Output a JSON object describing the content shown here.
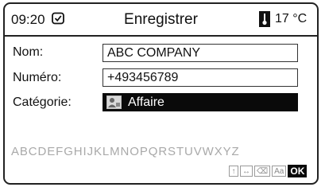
{
  "header": {
    "time": "09:20",
    "title": "Enregistrer",
    "temperature": "17 °C",
    "clock_icon": "clock-check-icon",
    "temperature_icon": "thermometer-icon"
  },
  "form": {
    "name_label": "Nom:",
    "name_value": "ABC COMPANY",
    "number_label": "Numéro:",
    "number_value": "+493456789",
    "category_label": "Catégorie:",
    "category_value": "Affaire",
    "category_icon": "business-contact-icon"
  },
  "keyboard": {
    "alphabet": "ABCDEFGHIJKLMNOPQRSTUVWXYZ",
    "shift_key": "↑",
    "cursor_key": "↔",
    "delete_key": "⌫",
    "case_key": "Aa",
    "ok_key": "OK"
  },
  "colors": {
    "selection_bg": "#0a0a0a",
    "inactive_text": "#a9a9a9"
  }
}
